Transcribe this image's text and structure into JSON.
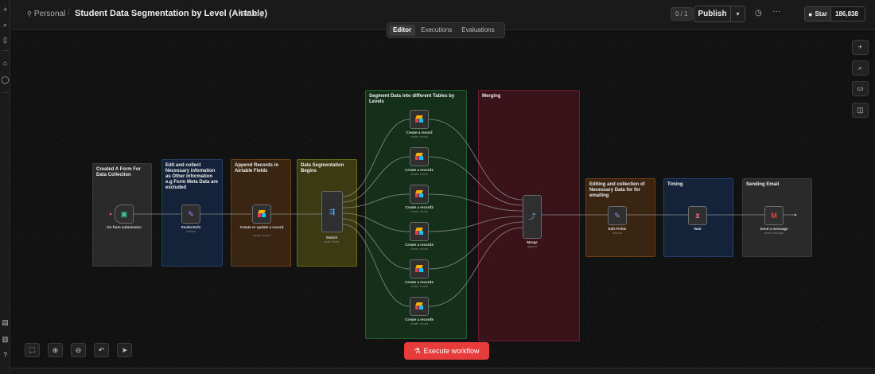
{
  "header": {
    "workspace": "Personal",
    "title": "Student Data Segmentation by Level (Airtable)",
    "add_tag": "+ Add tag",
    "counter": "0 / 1",
    "publish": "Publish",
    "github_star": "Star",
    "github_count": "186,838"
  },
  "tabs": [
    {
      "label": "Editor",
      "active": true
    },
    {
      "label": "Executions",
      "active": false
    },
    {
      "label": "Evaluations",
      "active": false
    }
  ],
  "stickies": {
    "form": "Created A Form For Data Collection",
    "edit": "Edit and collect Necessary infomation as Other information e.g Form Meta Data are excluded",
    "append": "Append Records in Airtable Fields",
    "segmentation": "Data Segmentation Begins",
    "segment_levels": "Segment Data into different Tables by Levels",
    "merging": "Merging",
    "editing_email": "Editing and collection of Necessary Data for for emailing",
    "timing": "Timing",
    "sending": "Sending Email"
  },
  "nodes": {
    "form": {
      "label": "On form submission",
      "sub": ""
    },
    "studentinfo": {
      "label": "StudentInfo",
      "sub": "manual"
    },
    "create_update": {
      "label": "Create or update a record",
      "sub": "upsert: record"
    },
    "switch": {
      "label": "Switch",
      "sub": "mode: Rules"
    },
    "rec0": {
      "label": "Create a record",
      "sub": "create: record"
    },
    "rec1": {
      "label": "Create a record1",
      "sub": "create: record"
    },
    "rec2": {
      "label": "Create a record2",
      "sub": "create: record"
    },
    "rec3": {
      "label": "Create a record3",
      "sub": "create: record"
    },
    "rec4": {
      "label": "Create a record4",
      "sub": "create: record"
    },
    "rec5": {
      "label": "Create a record5",
      "sub": "create: record"
    },
    "merge": {
      "label": "Merge",
      "sub": "append"
    },
    "edit_fields": {
      "label": "Edit Fields",
      "sub": "manual"
    },
    "wait": {
      "label": "Wait",
      "sub": ""
    },
    "send": {
      "label": "Send a message",
      "sub": "send: message"
    }
  },
  "footer": {
    "execute": "Execute workflow"
  },
  "colors": {
    "accent": "#e83c3c",
    "sticky_gray": "#2a2a2a",
    "sticky_blue": "#15233a",
    "sticky_orange": "#3a2412",
    "sticky_yellow": "#3b3a12",
    "sticky_green": "#14301a",
    "sticky_red": "#3a121a"
  },
  "icons": {
    "form": "clipboard-icon",
    "edit": "pencil-square-icon",
    "airtable": "airtable-icon",
    "switch": "switch-icon",
    "merge": "merge-icon",
    "wait": "hourglass-icon",
    "gmail": "gmail-icon"
  }
}
